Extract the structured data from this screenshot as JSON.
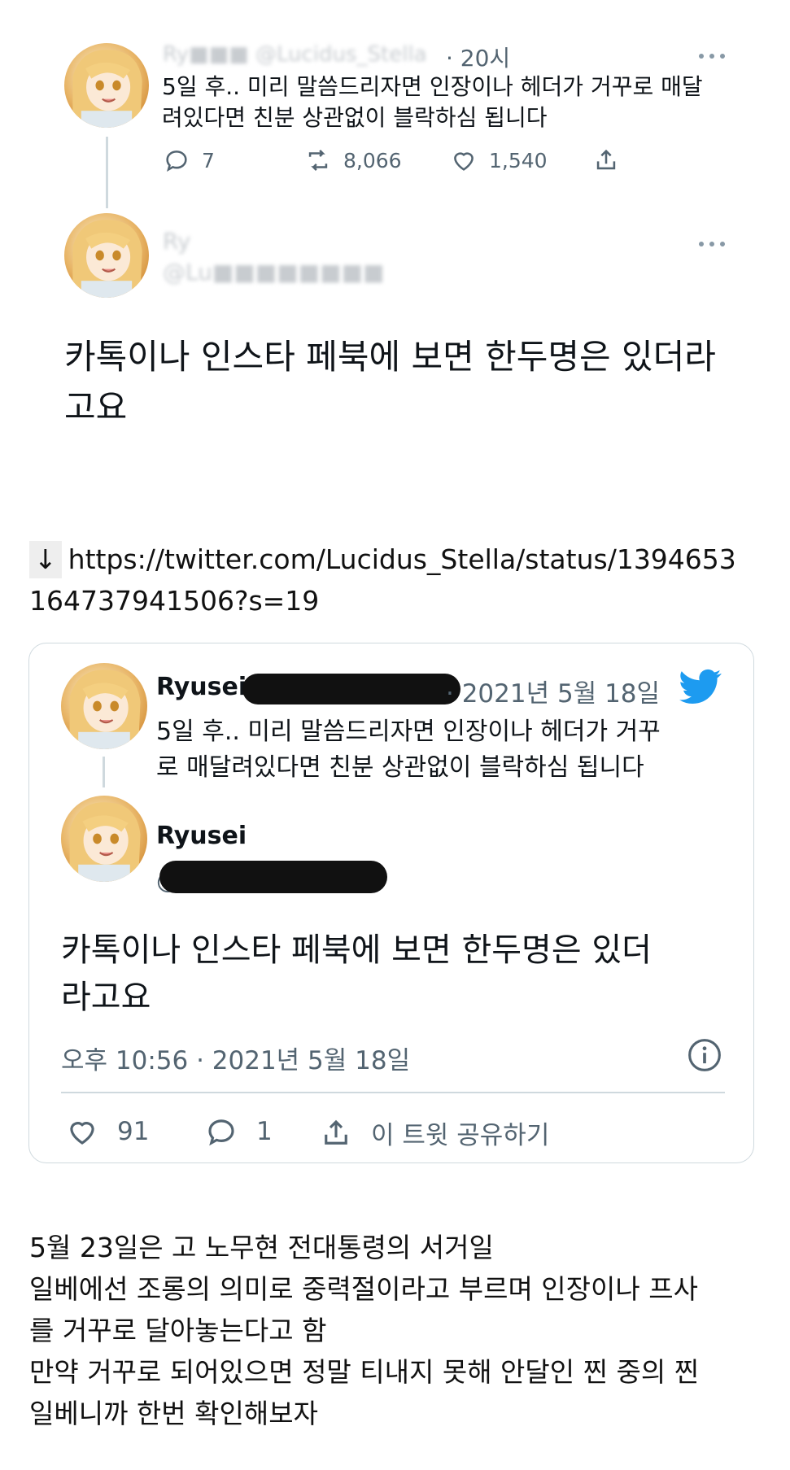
{
  "top_thread": {
    "tweet1": {
      "blurred_header": "Ry■■■ @Lucidus_Stella",
      "time": "· 20시",
      "text_line1": "5일 후.. 미리 말씀드리자면 인장이나 헤더가 거꾸로 매달",
      "text_line2": "려있다면 친분 상관없이 블락하심 됩니다",
      "reply_count": "7",
      "retweet_count": "8,066",
      "like_count": "1,540"
    },
    "tweet2": {
      "blurred_name": "Ry",
      "blurred_handle": "@Lu■■■■■■■■",
      "text_line1": "카톡이나 인스타 페북에 보면 한두명은 있더라",
      "text_line2": "고요"
    }
  },
  "link": {
    "arrow": "↓",
    "line1": "https://twitter.com/Lucidus_Stella/status/1394653",
    "line2": "164737941506?s=19"
  },
  "embed": {
    "tweet1": {
      "name": "Ryusei",
      "date": "· 2021년 5월 18일",
      "text_line1": "5일 후.. 미리 말씀드리자면 인장이나 헤더가 거꾸",
      "text_line2": "로 매달려있다면 친분 상관없이 블락하심 됩니다"
    },
    "tweet2": {
      "name": "Ryusei",
      "handle_hidden": "@",
      "text_line1": "카톡이나 인스타 페북에 보면 한두명은 있더",
      "text_line2": "라고요"
    },
    "timestamp": "오후 10:56 · 2021년 5월 18일",
    "like_count": "91",
    "reply_count": "1",
    "share_label": "이 트윗 공유하기",
    "colors": {
      "twitter_blue": "#1d9bf0",
      "gray": "#536471"
    }
  },
  "bottom": {
    "lines": [
      "5월 23일은 고 노무현 전대통령의 서거일",
      "일베에선 조롱의 의미로 중력절이라고 부르며 인장이나 프사",
      "를 거꾸로 달아놓는다고 함",
      "만약 거꾸로 되어있으면 정말 티내지 못해 안달인 찐 중의 찐",
      "일베니까 한번 확인해보자"
    ]
  }
}
